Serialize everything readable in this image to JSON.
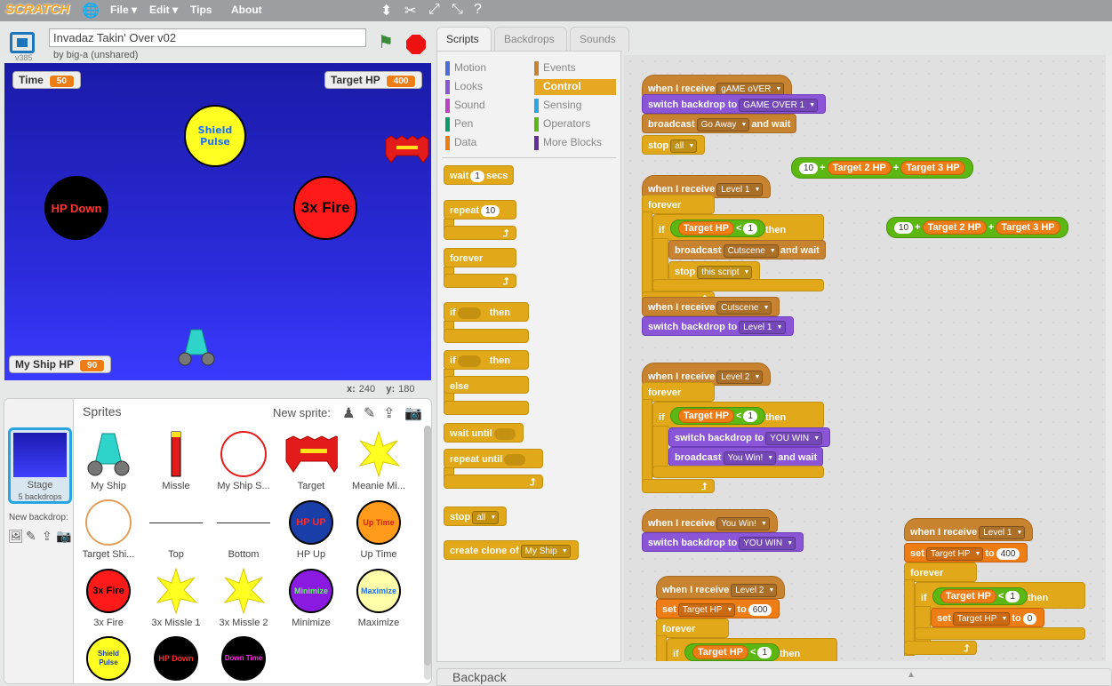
{
  "menu": {
    "logo": "SCRATCH",
    "file": "File",
    "edit": "Edit",
    "tips": "Tips",
    "about": "About"
  },
  "project": {
    "title": "Invadaz Takin' Over v02",
    "byline": "by big-a (unshared)",
    "version": "v385"
  },
  "monitors": {
    "time_label": "Time",
    "time_value": "50",
    "target_label": "Target HP",
    "target_value": "400",
    "ship_label": "My Ship HP",
    "ship_value": "90"
  },
  "stage_sprites": {
    "shield": "Shield Pulse",
    "hpdown": "HP Down",
    "fire": "3x Fire"
  },
  "coords": {
    "x_label": "x:",
    "x": "240",
    "y_label": "y:",
    "y": "180"
  },
  "sprites_pane": {
    "header": "Sprites",
    "new_sprite": "New sprite:",
    "stage_label": "Stage",
    "stage_backdrops": "5 backdrops",
    "new_backdrop": "New backdrop:"
  },
  "sprites": [
    {
      "name": "My Ship"
    },
    {
      "name": "Missle"
    },
    {
      "name": "My Ship S..."
    },
    {
      "name": "Target"
    },
    {
      "name": "Meanie Mi..."
    },
    {
      "name": "Target Shi..."
    },
    {
      "name": "Top"
    },
    {
      "name": "Bottom"
    },
    {
      "name": "HP Up",
      "thumb": "HP UP"
    },
    {
      "name": "Up Time",
      "thumb": "Up Time"
    },
    {
      "name": "3x Fire",
      "thumb": "3x Fire"
    },
    {
      "name": "3x Missle 1"
    },
    {
      "name": "3x Missle 2"
    },
    {
      "name": "Minimize",
      "thumb": "Minimize"
    },
    {
      "name": "Maximize",
      "thumb": "Maximize"
    },
    {
      "thumb": "Shield Pulse"
    },
    {
      "thumb": "HP Down"
    },
    {
      "thumb": "Down Time"
    }
  ],
  "tabs": [
    "Scripts",
    "Backdrops",
    "Sounds"
  ],
  "categories": {
    "motion": "Motion",
    "looks": "Looks",
    "sound": "Sound",
    "pen": "Pen",
    "data": "Data",
    "events": "Events",
    "control": "Control",
    "sensing": "Sensing",
    "operators": "Operators",
    "more": "More Blocks"
  },
  "palette": {
    "wait": "wait",
    "wait_n": "1",
    "secs": "secs",
    "repeat": "repeat",
    "repeat_n": "10",
    "forever": "forever",
    "if": "if",
    "then": "then",
    "else": "else",
    "wait_until": "wait until",
    "repeat_until": "repeat until",
    "stop": "stop",
    "stop_opt": "all",
    "create_clone": "create clone of",
    "clone_opt": "My Ship"
  },
  "scripts": {
    "s1_when": "when I receive",
    "s1_msg": "gAME oVER",
    "s1_switch": "switch backdrop to",
    "s1_bd": "GAME OVER 1",
    "s1_bc": "broadcast",
    "s1_bcmsg": "Go Away",
    "s1_andwait": "and wait",
    "s1_stop": "stop",
    "s1_stopopt": "all",
    "r1_num": "10",
    "r1_plus1": "+",
    "r1_v1": "Target 2 HP",
    "r1_plus2": "+",
    "r1_v2": "Target 3 HP",
    "r2_num": "10",
    "r2_plus1": "+",
    "r2_v1": "Target 2 HP",
    "r2_plus2": "+",
    "r2_v2": "Target 3 HP",
    "s2_when": "when I receive",
    "s2_msg": "Level 1",
    "s2_forever": "forever",
    "s2_if": "if",
    "s2_var": "Target HP",
    "s2_lt": "<",
    "s2_n": "1",
    "s2_then": "then",
    "s2_bc": "broadcast",
    "s2_bcmsg": "Cutscene",
    "s2_andwait": "and wait",
    "s2_stop": "stop",
    "s2_stopopt": "this script",
    "s3_when": "when I receive",
    "s3_msg": "Cutscene",
    "s3_switch": "switch backdrop to",
    "s3_bd": "Level 1",
    "s4_when": "when I receive",
    "s4_msg": "Level 2",
    "s4_forever": "forever",
    "s4_if": "if",
    "s4_var": "Target HP",
    "s4_lt": "<",
    "s4_n": "1",
    "s4_then": "then",
    "s4_switch": "switch backdrop to",
    "s4_bd": "YOU WIN",
    "s4_bc": "broadcast",
    "s4_bcmsg": "You Win!",
    "s4_andwait": "and wait",
    "s5_when": "when I receive",
    "s5_msg": "You Win!",
    "s5_switch": "switch backdrop to",
    "s5_bd": "YOU WIN",
    "s6_when": "when I receive",
    "s6_msg": "Level 2",
    "s6_set": "set",
    "s6_var": "Target HP",
    "s6_to": "to",
    "s6_val": "600",
    "s6_forever": "forever",
    "s6_if": "if",
    "s6_cvar": "Target HP",
    "s6_lt": "<",
    "s6_n": "1",
    "s6_then": "then",
    "s7_when": "when I receive",
    "s7_msg": "Level 1",
    "s7_set": "set",
    "s7_var": "Target HP",
    "s7_to": "to",
    "s7_val": "400",
    "s7_forever": "forever",
    "s7_if": "if",
    "s7_cvar": "Target HP",
    "s7_lt": "<",
    "s7_n": "1",
    "s7_then": "then",
    "s7_set2": "set",
    "s7_var2": "Target HP",
    "s7_to2": "to",
    "s7_val2": "0"
  },
  "backpack": "Backpack",
  "colors": {
    "control": "#e1a91a",
    "events": "#c88330",
    "looks": "#8a55d7",
    "data": "#ee7d16",
    "operators": "#5cb712",
    "stage_sky": "#2d2de0"
  }
}
